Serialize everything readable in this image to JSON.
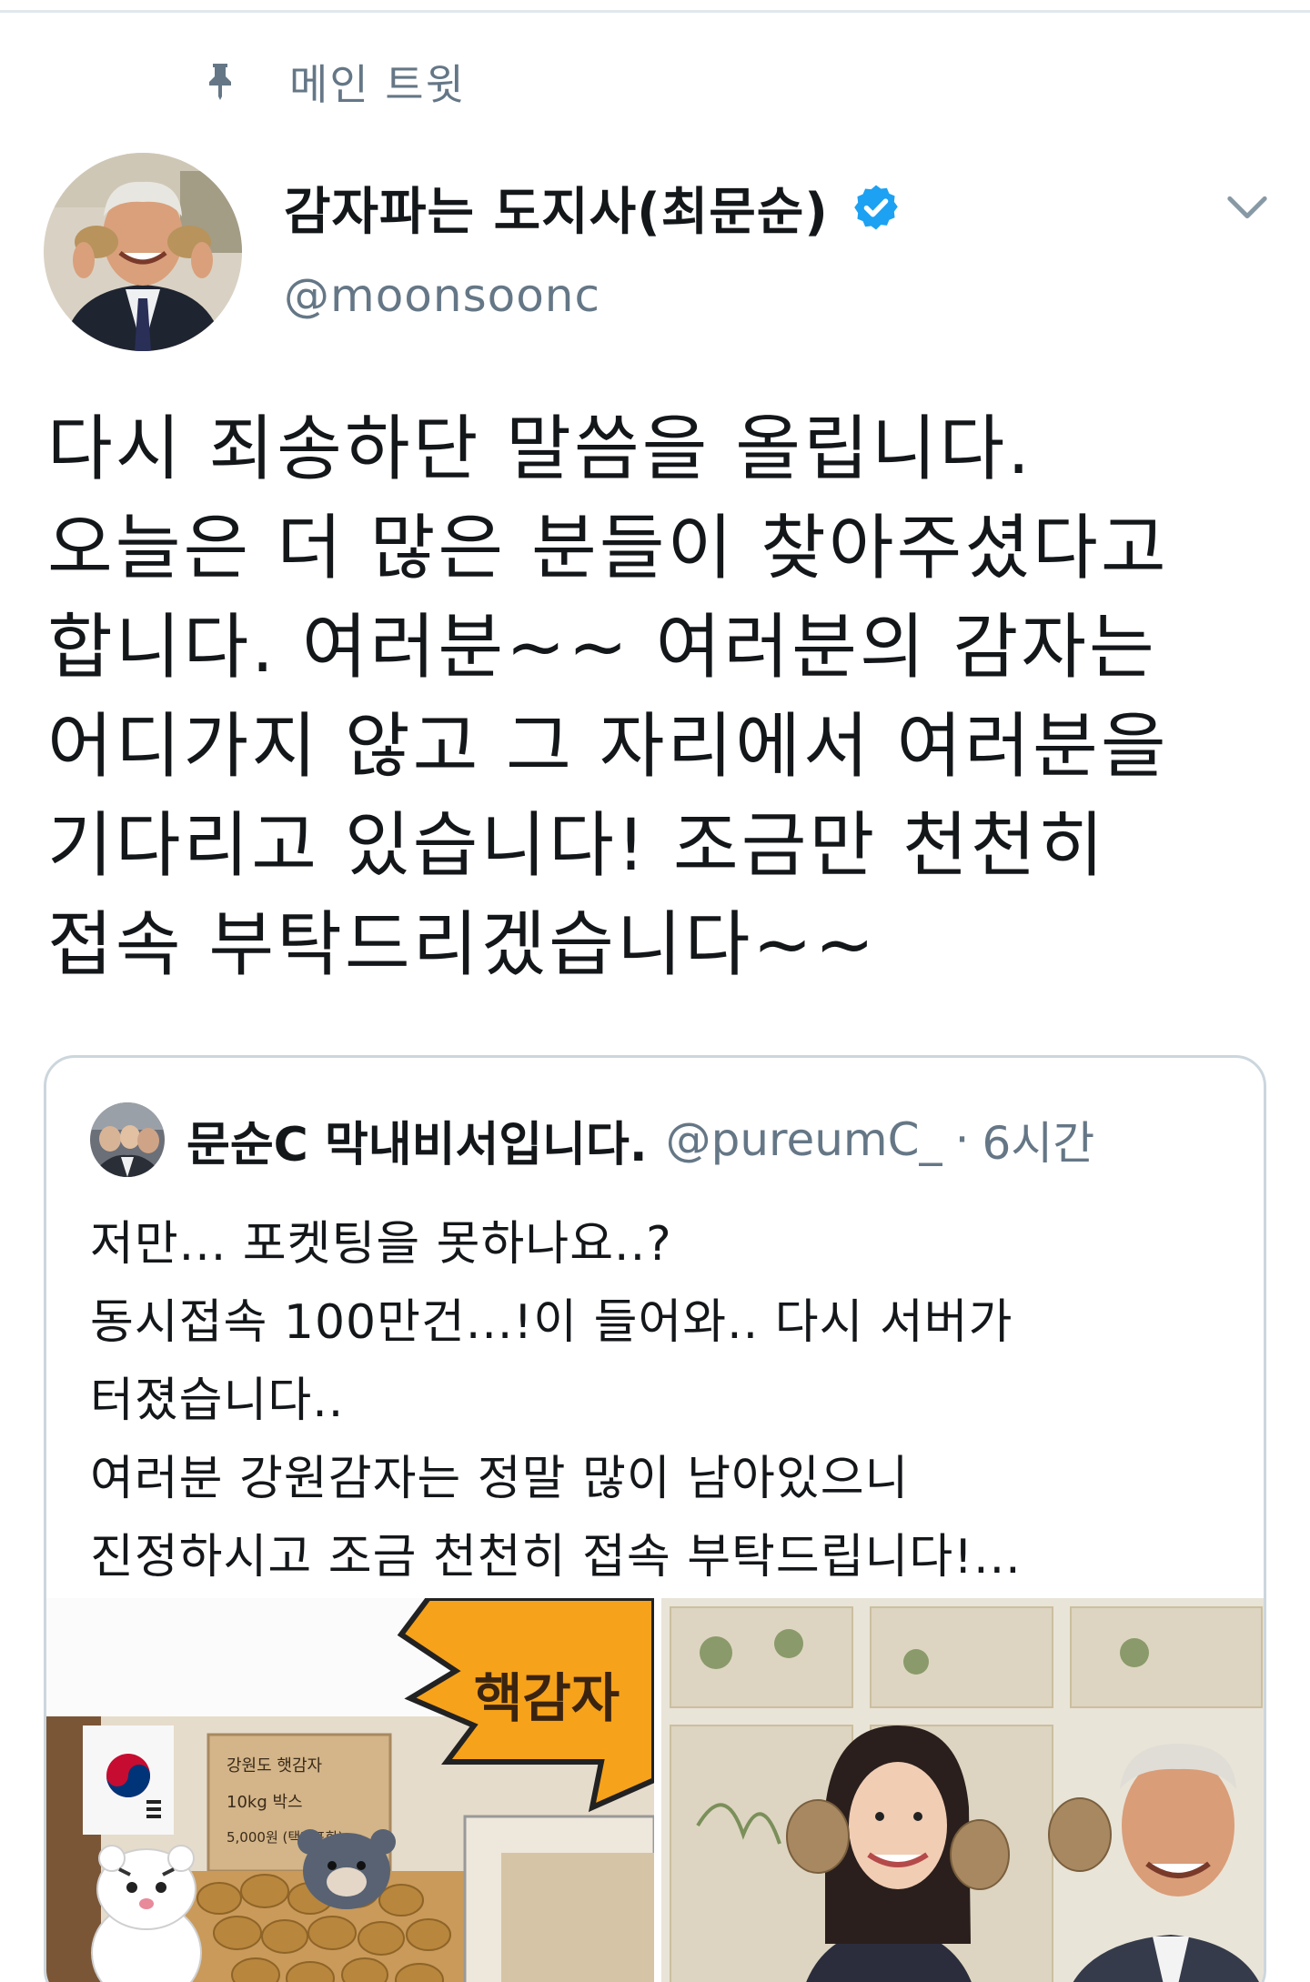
{
  "pinned": {
    "label": "메인 트윗",
    "icon": "pin-icon"
  },
  "author": {
    "display_name": "감자파는 도지사(최문순)",
    "handle": "@moonsoonc",
    "verified_icon": "verified-badge-icon",
    "menu_icon": "chevron-down-icon"
  },
  "tweet": {
    "lines": [
      "다시 죄송하단 말씀을 올립니다.",
      "오늘은 더 많은 분들이 찾아주셨다고",
      "합니다. 여러분~~ 여러분의 감자는",
      "어디가지 않고 그 자리에서 여러분을",
      "기다리고 있습니다! 조금만 천천히",
      "접속 부탁드리겠습니다~~"
    ]
  },
  "quote": {
    "name": "문순C 막내비서입니다.",
    "handle": "@pureumC_",
    "separator": "·",
    "time": "6시간",
    "lines": [
      "저만... 포켓팅을 못하나요..?",
      "동시접속 100만건...!이 들어와.. 다시 서버가",
      "터졌습니다..",
      "여러분 강원감자는 정말 많이 남아있으니",
      "진정하시고 조금 천천히 접속 부탁드립니다!..."
    ],
    "media": {
      "left": {
        "badge_text": "핵감자",
        "box_label_1": "강원도 햇감자",
        "box_label_2": "10kg 박스",
        "box_label_3": "5,000원 (택배포함)"
      }
    }
  },
  "colors": {
    "text": "#14171a",
    "secondary": "#657786",
    "verified": "#1da1f2",
    "border": "#ccd6dd",
    "badge": "#f7a21b"
  }
}
